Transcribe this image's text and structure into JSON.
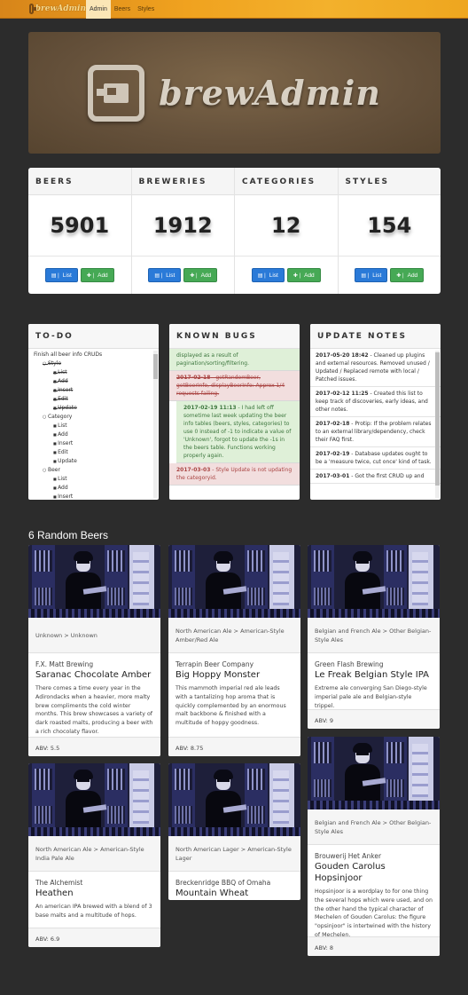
{
  "nav": {
    "brand": "brewAdmin",
    "items": [
      {
        "label": "Admin",
        "active": true
      },
      {
        "label": "Beers",
        "active": false
      },
      {
        "label": "Styles",
        "active": false
      }
    ]
  },
  "banner": {
    "title": "brewAdmin"
  },
  "stats": [
    {
      "title": "BEERS",
      "count": "5901",
      "list": "List",
      "add": "Add"
    },
    {
      "title": "BREWERIES",
      "count": "1912",
      "list": "List",
      "add": "Add"
    },
    {
      "title": "CATEGORIES",
      "count": "12",
      "list": "List",
      "add": "Add"
    },
    {
      "title": "STYLES",
      "count": "154",
      "list": "List",
      "add": "Add"
    }
  ],
  "todo": {
    "title": "TO-DO",
    "intro": "Finish all beer info CRUDs",
    "groups": [
      {
        "name": "Style",
        "done": true,
        "items": [
          {
            "label": "List",
            "done": true
          },
          {
            "label": "Add",
            "done": true
          },
          {
            "label": "Insert",
            "done": true
          },
          {
            "label": "Edit",
            "done": true
          },
          {
            "label": "Update",
            "done": true
          }
        ]
      },
      {
        "name": "Category",
        "done": false,
        "items": [
          {
            "label": "List",
            "done": false
          },
          {
            "label": "Add",
            "done": false
          },
          {
            "label": "Insert",
            "done": false
          },
          {
            "label": "Edit",
            "done": false
          },
          {
            "label": "Update",
            "done": false
          }
        ]
      },
      {
        "name": "Beer",
        "done": false,
        "items": [
          {
            "label": "List",
            "done": false
          },
          {
            "label": "Add",
            "done": false
          },
          {
            "label": "Insert",
            "done": false
          }
        ]
      }
    ]
  },
  "bugs": {
    "title": "KNOWN BUGS",
    "entries": [
      {
        "variant": "green",
        "indent": false,
        "strike": false,
        "date": "",
        "text": "displayed as a result of pagination/sorting/filtering."
      },
      {
        "variant": "red",
        "indent": false,
        "strike": true,
        "date": "2017-02-18",
        "text": " - getRandomBeer, getBeerInfo, displayBeerInfo: Approx 1/4 requests failing."
      },
      {
        "variant": "green",
        "indent": true,
        "strike": false,
        "date": "2017-02-19 11:13",
        "text": " - I had left off sometime last week updating the beer info tables (beers, styles, categories) to use 0 instead of -1 to indicate a value of 'Unknown', forgot to update the -1s in the beers table. Functions working properly again."
      },
      {
        "variant": "red",
        "indent": false,
        "strike": false,
        "date": "2017-03-03",
        "text": " - Style Update is not updating the categoryid."
      }
    ]
  },
  "notes": {
    "title": "UPDATE NOTES",
    "entries": [
      {
        "date": "2017-05-20 18:42",
        "text": " - Cleaned up plugins and external resources. Removed unused / Updated / Replaced remote with local / Patched issues."
      },
      {
        "date": "2017-02-12 11:25",
        "text": " - Created this list to keep track of discoveries, early ideas, and other notes."
      },
      {
        "date": "2017-02-18",
        "text": " - Protip: If the problem relates to an external library/dependency, check their FAQ first."
      },
      {
        "date": "2017-02-19",
        "text": " - Database updates ought to be a 'measure twice, cut once' kind of task."
      },
      {
        "date": "2017-03-01",
        "text": " - Got the first CRUD up and"
      }
    ]
  },
  "random": {
    "title": "6 Random Beers",
    "beers": [
      {
        "crumb": "Unknown > Unknown",
        "brewery": "F.X. Matt Brewing",
        "name": "Saranac Chocolate Amber",
        "desc": "There comes a time every year in the Adirondacks when a heavier, more malty brew compliments the cold winter months. This brew showcases a variety of dark roasted malts, producing a beer with a rich chocolaty flavor.",
        "abv": "ABV: 5.5"
      },
      {
        "crumb": "North American Ale > American-Style Amber/Red Ale",
        "brewery": "Terrapin Beer Company",
        "name": "Big Hoppy Monster",
        "desc": "This mammoth imperial red ale leads with a tantalizing hop aroma that is quickly complemented by an enormous malt backbone & finished with a multitude of hoppy goodness.",
        "abv": "ABV: 8.75"
      },
      {
        "crumb": "Belgian and French Ale > Other Belgian-Style Ales",
        "brewery": "Green Flash Brewing",
        "name": "Le Freak Belgian Style IPA",
        "desc": "Extreme ale converging San Diego-style imperial pale ale and Belgian-style trippel.",
        "abv": "ABV: 9"
      },
      {
        "crumb": "North American Ale > American-Style India Pale Ale",
        "brewery": "The Alchemist",
        "name": "Heathen",
        "desc": "An american IPA brewed with a blend of 3 base malts and a multitude of hops.",
        "abv": "ABV: 6.9"
      },
      {
        "crumb": "North American Lager > American-Style Lager",
        "brewery": "Breckenridge BBQ of Omaha",
        "name": "Mountain Wheat",
        "desc": "",
        "abv": ""
      },
      {
        "crumb": "Belgian and French Ale > Other Belgian-Style Ales",
        "brewery": "Brouwerij Het Anker",
        "name": "Gouden Carolus Hopsinjoor",
        "desc": "Hopsinjoor is a wordplay to for one thing the several hops which were used, and on the other hand the typical character of Mechelen of Gouden Carolus: the figure \"opsinjoor\" is intertwined with the history of Mechelen.",
        "abv": "ABV: 8"
      }
    ]
  },
  "icons": {
    "list": "list-icon",
    "add": "plus-icon",
    "logo": "beer-mug-icon"
  }
}
